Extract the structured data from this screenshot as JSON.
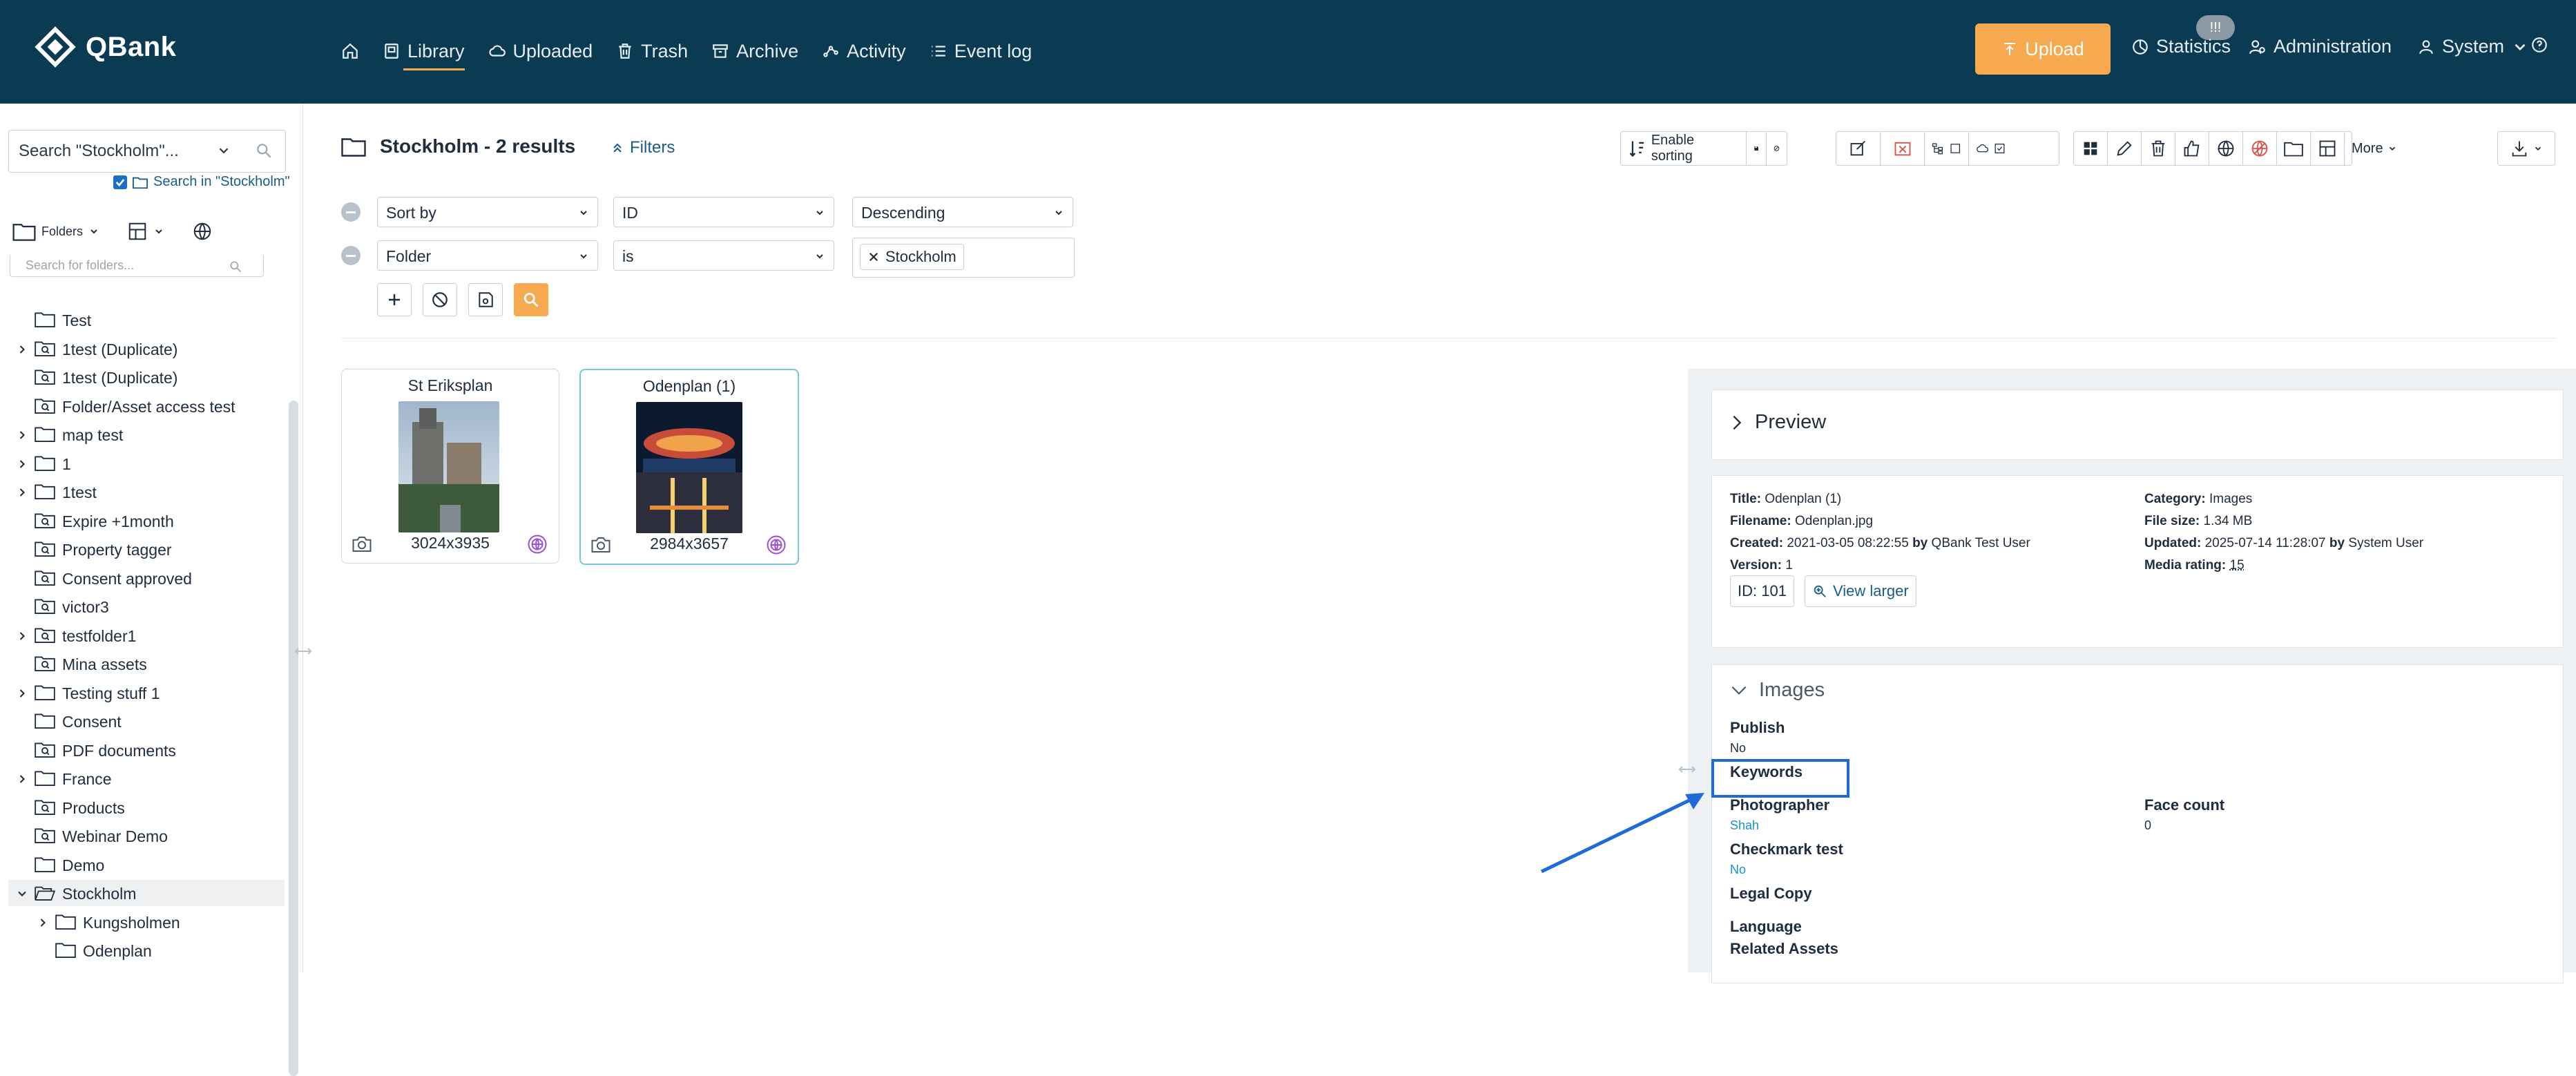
{
  "app": {
    "name": "QBank"
  },
  "nav": {
    "items": [
      {
        "label": "",
        "icon": "home-icon"
      },
      {
        "label": "Library",
        "icon": "library-icon",
        "active": true
      },
      {
        "label": "Uploaded",
        "icon": "cloud-icon"
      },
      {
        "label": "Trash",
        "icon": "trash-icon"
      },
      {
        "label": "Archive",
        "icon": "archive-icon"
      },
      {
        "label": "Activity",
        "icon": "activity-icon"
      },
      {
        "label": "Event log",
        "icon": "list-icon"
      }
    ],
    "upload_label": "Upload",
    "notification_badge": "!!!",
    "statistics_label": "Statistics",
    "administration_label": "Administration",
    "system_label": "System"
  },
  "sidebar": {
    "search_text": "Search \"Stockholm\"...",
    "search_in_label": "Search in \"Stockholm\"",
    "folders_label": "Folders",
    "folder_search_placeholder": "Search for folders...",
    "tree": [
      {
        "label": "Test",
        "expandable": false,
        "icon": "folder",
        "indent": 0
      },
      {
        "label": "1test (Duplicate)",
        "expandable": true,
        "icon": "folder-search",
        "indent": 0
      },
      {
        "label": "1test (Duplicate)",
        "expandable": false,
        "icon": "folder-search",
        "indent": 0
      },
      {
        "label": "Folder/Asset access test",
        "expandable": false,
        "icon": "folder-search",
        "indent": 0
      },
      {
        "label": "map test",
        "expandable": true,
        "icon": "folder",
        "indent": 0
      },
      {
        "label": "1",
        "expandable": true,
        "icon": "folder",
        "indent": 0
      },
      {
        "label": "1test",
        "expandable": true,
        "icon": "folder",
        "indent": 0
      },
      {
        "label": "Expire +1month",
        "expandable": false,
        "icon": "folder-search",
        "indent": 0
      },
      {
        "label": "Property tagger",
        "expandable": false,
        "icon": "folder-search",
        "indent": 0
      },
      {
        "label": "Consent approved",
        "expandable": false,
        "icon": "folder-search",
        "indent": 0
      },
      {
        "label": "victor3",
        "expandable": false,
        "icon": "folder-search",
        "indent": 0
      },
      {
        "label": "testfolder1",
        "expandable": true,
        "icon": "folder-search",
        "indent": 0
      },
      {
        "label": "Mina assets",
        "expandable": false,
        "icon": "folder-search",
        "indent": 0
      },
      {
        "label": "Testing stuff 1",
        "expandable": true,
        "icon": "folder",
        "indent": 0
      },
      {
        "label": "Consent",
        "expandable": false,
        "icon": "folder",
        "indent": 0
      },
      {
        "label": "PDF documents",
        "expandable": false,
        "icon": "folder-search",
        "indent": 0
      },
      {
        "label": "France",
        "expandable": true,
        "icon": "folder",
        "indent": 0
      },
      {
        "label": "Products",
        "expandable": false,
        "icon": "folder-search",
        "indent": 0
      },
      {
        "label": "Webinar Demo",
        "expandable": false,
        "icon": "folder-search",
        "indent": 0
      },
      {
        "label": "Demo",
        "expandable": false,
        "icon": "folder",
        "indent": 0
      },
      {
        "label": "Stockholm",
        "expandable": true,
        "expanded": true,
        "icon": "folder-open",
        "indent": 0,
        "selected": true
      },
      {
        "label": "Kungsholmen",
        "expandable": true,
        "icon": "folder",
        "indent": 1
      },
      {
        "label": "Odenplan",
        "expandable": false,
        "icon": "folder",
        "indent": 1
      }
    ]
  },
  "main": {
    "title": "Stockholm - 2 results",
    "filters_label": "Filters",
    "enable_sorting_label": "Enable sorting",
    "more_label": "More",
    "sort_row": {
      "field": "Sort by",
      "key": "ID",
      "order": "Descending"
    },
    "filter_row": {
      "field": "Folder",
      "op": "is",
      "chip": "Stockholm"
    },
    "cards": [
      {
        "title": "St Eriksplan",
        "dimensions": "3024x3935",
        "selected": false
      },
      {
        "title": "Odenplan (1)",
        "dimensions": "2984x3657",
        "selected": true
      }
    ]
  },
  "detail": {
    "preview_label": "Preview",
    "title_label": "Title:",
    "title_value": "Odenplan (1)",
    "filename_label": "Filename:",
    "filename_value": "Odenplan.jpg",
    "created_label": "Created:",
    "created_value": "2021-03-05 08:22:55",
    "by_label": "by",
    "created_by": "QBank Test User",
    "version_label": "Version:",
    "version_value": "1",
    "category_label": "Category:",
    "category_value": "Images",
    "filesize_label": "File size:",
    "filesize_value": "1.34 MB",
    "updated_label": "Updated:",
    "updated_value": "2025-07-14 11:28:07",
    "updated_by": "System User",
    "rating_label": "Media rating:",
    "rating_value": "15",
    "id_label": "ID: 101",
    "view_larger_label": "View larger",
    "section_label": "Images",
    "fields": {
      "publish_label": "Publish",
      "publish_value": "No",
      "keywords_label": "Keywords",
      "photographer_label": "Photographer",
      "photographer_value": "Shah",
      "face_count_label": "Face count",
      "face_count_value": "0",
      "checkmark_label": "Checkmark test",
      "checkmark_value": "No",
      "legal_copy_label": "Legal Copy",
      "language_label": "Language",
      "related_label": "Related Assets"
    }
  },
  "colors": {
    "topbar": "#0b3b53",
    "accent": "#f7a94f",
    "link": "#1a5c8a",
    "highlight": "#1f6bd6"
  }
}
